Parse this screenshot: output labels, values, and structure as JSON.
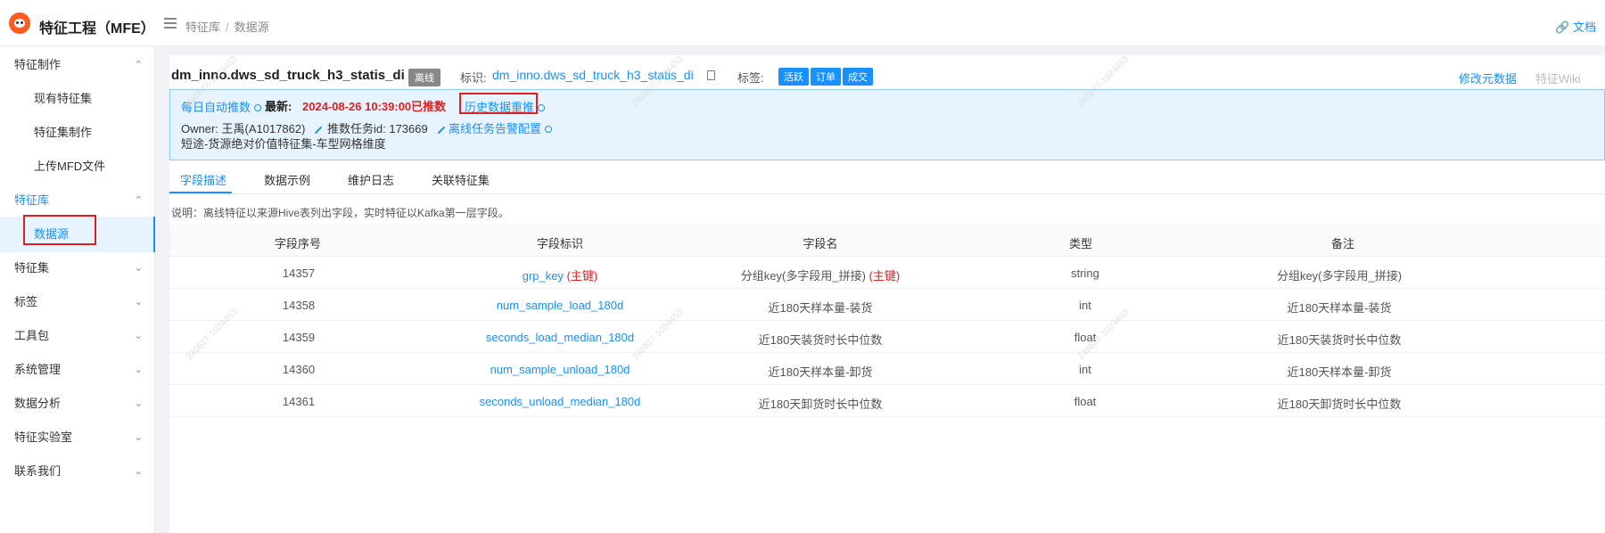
{
  "header": {
    "app_title": "特征工程（MFE）",
    "breadcrumb": [
      "特征库",
      "数据源"
    ],
    "doc_link": "文档"
  },
  "sidebar": {
    "items": [
      {
        "label": "特征制作",
        "type": "group",
        "arrow": "^"
      },
      {
        "label": "现有特征集",
        "type": "sub"
      },
      {
        "label": "特征集制作",
        "type": "sub"
      },
      {
        "label": "上传MFD文件",
        "type": "sub"
      },
      {
        "label": "特征库",
        "type": "group",
        "arrow": "^"
      },
      {
        "label": "数据源",
        "type": "sub"
      },
      {
        "label": "特征集",
        "type": "group",
        "arrow": "v"
      },
      {
        "label": "标签",
        "type": "group",
        "arrow": "v"
      },
      {
        "label": "工具包",
        "type": "group",
        "arrow": "v"
      },
      {
        "label": "系统管理",
        "type": "group",
        "arrow": "v"
      },
      {
        "label": "数据分析",
        "type": "group",
        "arrow": "v"
      },
      {
        "label": "特征实验室",
        "type": "group",
        "arrow": "v"
      },
      {
        "label": "联系我们",
        "type": "group",
        "arrow": "v"
      }
    ]
  },
  "detail": {
    "title": "dm_inno.dws_sd_truck_h3_statis_di",
    "offline_tag": "离线",
    "ident_label": "标识:",
    "ident_value": "dm_inno.dws_sd_truck_h3_statis_di",
    "tags_label": "标签:",
    "tags": [
      "活跃",
      "订单",
      "成交"
    ],
    "edit_meta": "修改元数据",
    "wiki": "特征Wiki",
    "auto_push": "每日自动推数",
    "latest_label": "最新:",
    "latest_value": "2024-08-26 10:39:00已推数",
    "history_push": "历史数据重推",
    "owner": "Owner: 王禹(A1017862)",
    "task_id": "推数任务id: 173669",
    "alert_config": "离线任务告警配置",
    "description": "短途-货源绝对价值特征集-车型网格维度"
  },
  "tabs": [
    "字段描述",
    "数据示例",
    "维护日志",
    "关联特征集"
  ],
  "note": "说明：离线特征以来源Hive表列出字段，实时特征以Kafka第一层字段。",
  "table": {
    "headers": [
      "字段序号",
      "字段标识",
      "字段名",
      "类型",
      "备注"
    ],
    "pk_label": "(主键)",
    "rows": [
      {
        "seq": "14357",
        "key": "grp_key",
        "name": "分组key(多字段用_拼接)",
        "type": "string",
        "remark": "分组key(多字段用_拼接)",
        "pk": true
      },
      {
        "seq": "14358",
        "key": "num_sample_load_180d",
        "name": "近180天样本量-装货",
        "type": "int",
        "remark": "近180天样本量-装货",
        "pk": false
      },
      {
        "seq": "14359",
        "key": "seconds_load_median_180d",
        "name": "近180天装货时长中位数",
        "type": "float",
        "remark": "近180天装货时长中位数",
        "pk": false
      },
      {
        "seq": "14360",
        "key": "num_sample_unload_180d",
        "name": "近180天样本量-卸货",
        "type": "int",
        "remark": "近180天样本量-卸货",
        "pk": false
      },
      {
        "seq": "14361",
        "key": "seconds_unload_median_180d",
        "name": "近180天卸货时长中位数",
        "type": "float",
        "remark": "近180天卸货时长中位数",
        "pk": false
      }
    ]
  },
  "watermark_text": "240827-1024453",
  "colors": {
    "accent": "#1890ff",
    "danger": "#e02020",
    "info_bg": "#e8f4fd"
  }
}
